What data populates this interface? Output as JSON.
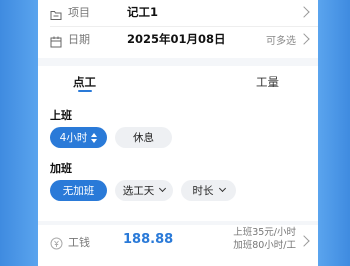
{
  "form": {
    "project": {
      "label": "项目",
      "value": "记工1"
    },
    "date": {
      "label": "日期",
      "value": "2025年01月08日",
      "hint": "可多选"
    }
  },
  "tabs": [
    {
      "label": "点工",
      "active": true
    },
    {
      "label": "工量",
      "active": false
    }
  ],
  "regular_shift": {
    "label": "上班",
    "options": [
      {
        "label": "4小时",
        "selected": true
      },
      {
        "label": "休息",
        "selected": false
      }
    ]
  },
  "overtime": {
    "label": "加班",
    "options": [
      {
        "label": "无加班",
        "selected": true
      },
      {
        "label": "选工天",
        "selected": false
      },
      {
        "label": "时长",
        "selected": false
      }
    ]
  },
  "wage": {
    "label": "工钱",
    "value": "188.88",
    "desc_line1": "上班35元/小时",
    "desc_line2": "加班80小时/工"
  },
  "colors": {
    "accent": "#2a7ad8",
    "background": "#f4f6f9",
    "frame": "#4a90e2"
  }
}
